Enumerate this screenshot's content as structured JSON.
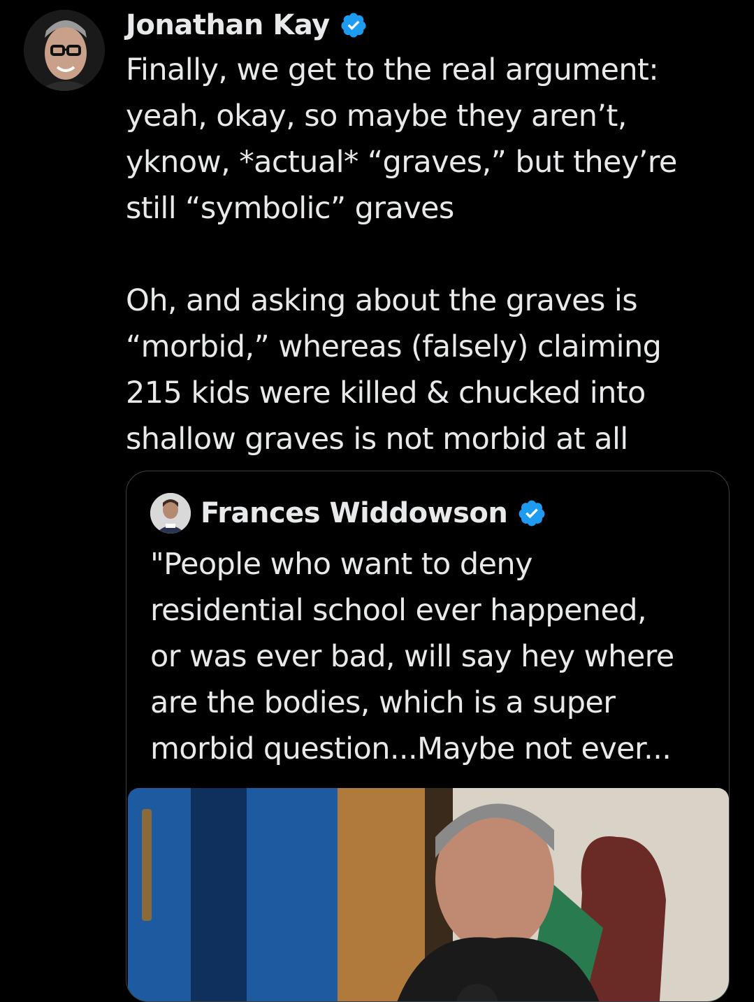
{
  "tweet": {
    "author": {
      "name": "Jonathan Kay",
      "verified": true,
      "avatar_icon": "profile-photo-man-glasses"
    },
    "paragraphs": [
      "Finally, we get to the real argument: yeah, okay, so maybe they aren’t, yknow, *actual* “graves,” but they’re still “symbolic” graves",
      "Oh, and asking about the graves is “morbid,” whereas (falsely) claiming 215 kids were killed & chucked into shallow graves is not morbid at all"
    ],
    "lines_1": [
      "Finally, we get to the real argument:",
      "yeah, okay, so maybe they aren’t,",
      "yknow, *actual* “graves,” but they’re",
      "still “symbolic” graves"
    ],
    "lines_2": [
      "Oh, and asking about the graves is",
      "“morbid,” whereas (falsely) claiming",
      "215 kids were killed & chucked into",
      "shallow graves is not morbid at all"
    ]
  },
  "quoted_tweet": {
    "author": {
      "name": "Frances Widdowson",
      "verified": true,
      "avatar_icon": "profile-photo-small"
    },
    "lines": [
      "\"People who want to deny",
      "residential school ever happened,",
      "or was ever bad, will say hey where",
      "are the bodies, which is a super",
      "morbid question...Maybe not ever..."
    ],
    "media_icon": "video-thumbnail-man-speaking"
  },
  "colors": {
    "background": "#000000",
    "text": "#e7e9ea",
    "verified": "#1d9bf0",
    "border": "#3a3f44"
  }
}
